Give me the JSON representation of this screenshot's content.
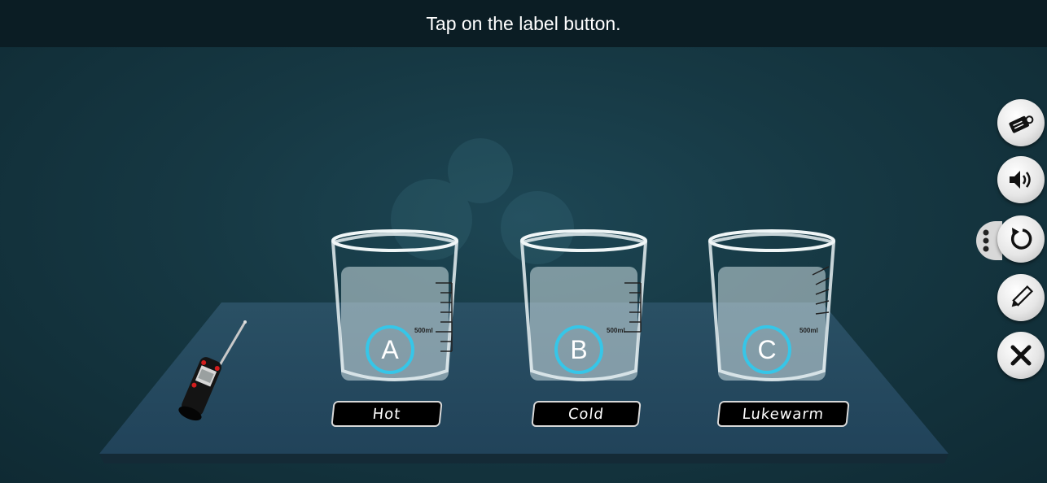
{
  "instruction": "Tap on the label button.",
  "beakers": [
    {
      "letter": "A",
      "volume": "500ml"
    },
    {
      "letter": "B",
      "volume": "500ml"
    },
    {
      "letter": "C",
      "volume": "500ml"
    }
  ],
  "labels": [
    "Hot",
    "Cold",
    "Lukewarm"
  ],
  "toolbar": [
    {
      "name": "label-tag-icon"
    },
    {
      "name": "speaker-icon"
    },
    {
      "name": "reset-icon"
    },
    {
      "name": "pencil-icon"
    },
    {
      "name": "close-icon"
    }
  ],
  "colors": {
    "accent": "#36c6e8",
    "table": "#23465a"
  }
}
